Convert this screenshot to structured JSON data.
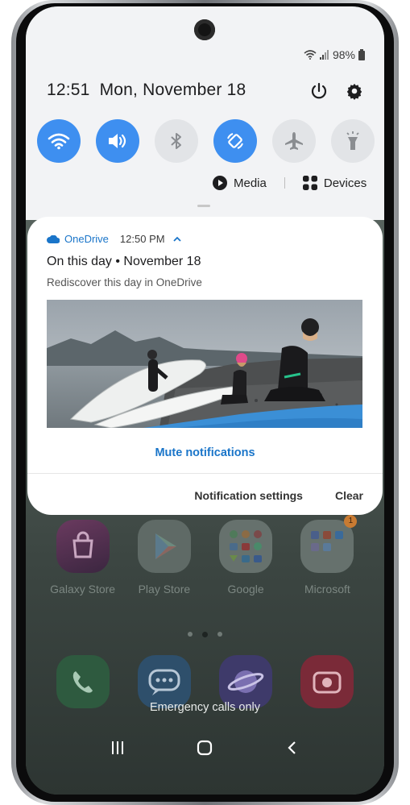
{
  "status_bar": {
    "battery": "98%",
    "wifi_icon": "wifi-icon",
    "signal_icon": "signal-icon",
    "battery_icon": "battery-icon"
  },
  "quick_panel": {
    "time": "12:51",
    "date": "Mon, November 18",
    "power_icon": "power-icon",
    "settings_icon": "gear-icon",
    "tiles": [
      {
        "name": "wifi-toggle",
        "icon": "wifi-icon",
        "on": true
      },
      {
        "name": "sound-toggle",
        "icon": "speaker-icon",
        "on": true
      },
      {
        "name": "bluetooth-toggle",
        "icon": "bluetooth-icon",
        "on": false
      },
      {
        "name": "auto-rotate-toggle",
        "icon": "rotate-icon",
        "on": true
      },
      {
        "name": "airplane-toggle",
        "icon": "airplane-icon",
        "on": false
      },
      {
        "name": "flashlight-toggle",
        "icon": "flashlight-icon",
        "on": false
      }
    ],
    "media_label": "Media",
    "devices_label": "Devices",
    "accent_color": "#3e8ff0"
  },
  "notification": {
    "app_name": "OneDrive",
    "time": "12:50 PM",
    "title": "On this day • November 18",
    "body": "Rediscover this day in OneDrive",
    "mute_label": "Mute notifications",
    "settings_label": "Notification settings",
    "clear_label": "Clear",
    "app_color": "#1a75c9"
  },
  "home": {
    "apps": [
      {
        "label": "Galaxy Store"
      },
      {
        "label": "Play Store"
      },
      {
        "label": "Google"
      },
      {
        "label": "Microsoft",
        "badge": "1"
      }
    ],
    "emergency_text": "Emergency calls only"
  },
  "navbar": {
    "recents_icon": "recents-icon",
    "home_icon": "home-icon",
    "back_icon": "back-icon"
  }
}
